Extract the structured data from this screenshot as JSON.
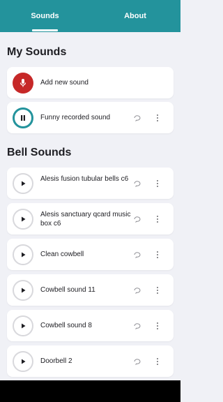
{
  "tabs": [
    {
      "label": "Sounds",
      "active": true
    },
    {
      "label": "About",
      "active": false
    }
  ],
  "colors": {
    "header": "#23939c",
    "record": "#c62828",
    "background": "#f0f1f6"
  },
  "my_sounds": {
    "title": "My Sounds",
    "add_label": "Add new sound",
    "items": [
      {
        "name": "Funny recorded sound",
        "state": "playing",
        "icon": "pause-icon"
      }
    ]
  },
  "bell_sounds": {
    "title": "Bell Sounds",
    "items": [
      {
        "name": "Alesis fusion tubular bells c6",
        "icon": "play-icon"
      },
      {
        "name": "Alesis sanctuary qcard music box c6",
        "icon": "play-icon"
      },
      {
        "name": "Clean cowbell",
        "icon": "play-icon"
      },
      {
        "name": "Cowbell sound 11",
        "icon": "play-icon"
      },
      {
        "name": "Cowbell sound 8",
        "icon": "play-icon"
      },
      {
        "name": "Doorbell 2",
        "icon": "play-icon"
      }
    ]
  }
}
